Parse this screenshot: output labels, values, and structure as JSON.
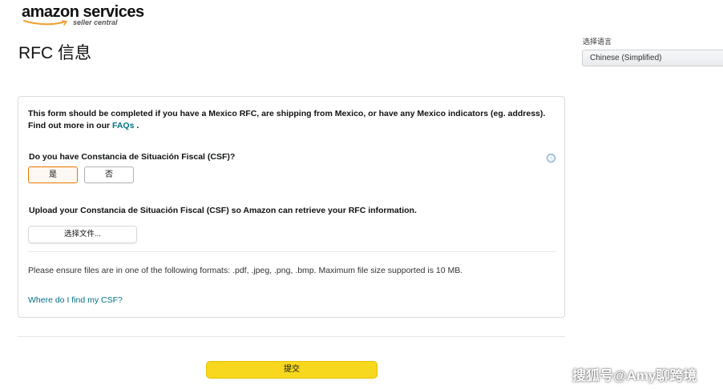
{
  "header": {
    "logo_main": "amazon services",
    "logo_sub": "seller central",
    "page_title": "RFC 信息"
  },
  "language": {
    "label": "选择语言",
    "selected": "Chinese (Simplified)"
  },
  "form": {
    "intro_text": "This form should be completed if you have a Mexico RFC, are shipping from Mexico, or have any Mexico indicators (eg. address). Find out more in our ",
    "faqs_link": "FAQs",
    "intro_end": " .",
    "csf_question": "Do you have Constancia de Situación Fiscal (CSF)?",
    "info_icon": "ⓘ",
    "options": {
      "yes": "是",
      "no": "否",
      "selected": "yes"
    },
    "upload_instruction": "Upload your Constancia de Situación Fiscal (CSF) so Amazon can retrieve your RFC information.",
    "choose_file_label": "选择文件...",
    "formats_note": "Please ensure files are in one of the following formats: .pdf, .jpeg, .png, .bmp. Maximum file size supported is 10 MB.",
    "where_csf_link": "Where do I find my CSF?"
  },
  "footer": {
    "submit_label": "提交"
  },
  "watermark": "搜狐号@Amy聊跨境",
  "colors": {
    "link": "#007185",
    "submit_bg": "#f7d81e",
    "selected_option_border": "#e77600"
  }
}
